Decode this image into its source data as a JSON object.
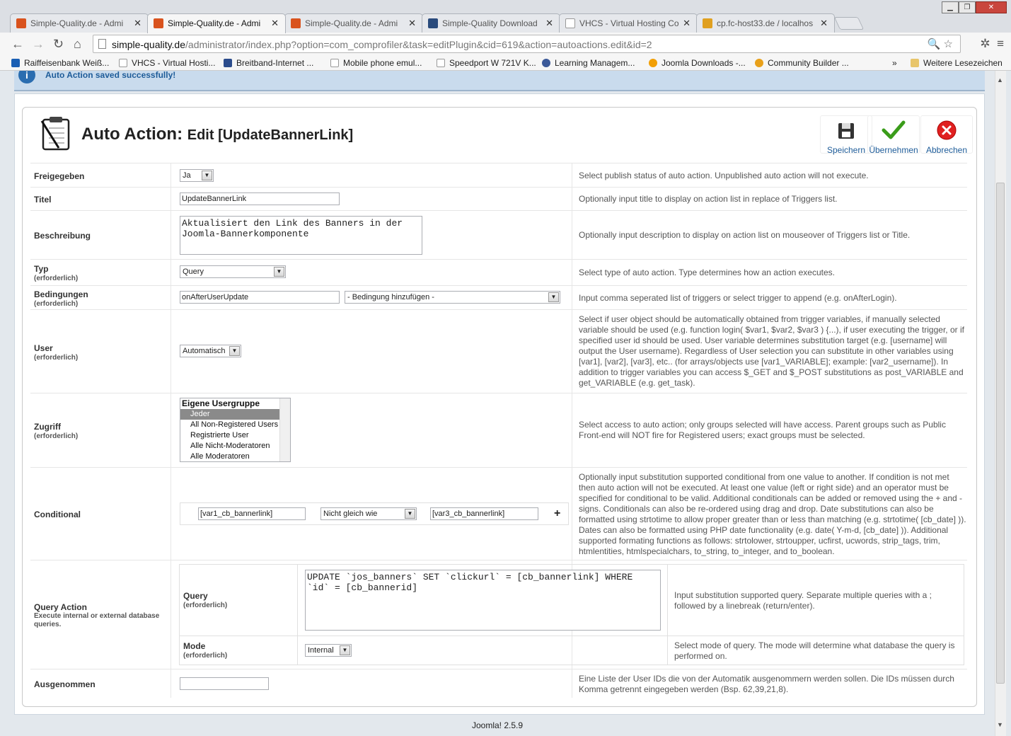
{
  "browser": {
    "tabs": [
      {
        "title": "Simple-Quality.de - Admi",
        "favicon_color": "#d9531e",
        "active": false
      },
      {
        "title": "Simple-Quality.de - Admi",
        "favicon_color": "#d9531e",
        "active": true
      },
      {
        "title": "Simple-Quality.de - Admi",
        "favicon_color": "#d9531e",
        "active": false
      },
      {
        "title": "Simple-Quality Download",
        "favicon_color": "#2a4b7c",
        "active": false
      },
      {
        "title": "VHCS - Virtual Hosting Co",
        "favicon_color": "#cccccc",
        "active": false
      },
      {
        "title": "cp.fc-host33.de / localhos",
        "favicon_color": "#e0a020",
        "active": false
      }
    ],
    "url_host": "simple-quality.de",
    "url_path": "/administrator/index.php?option=com_comprofiler&task=editPlugin&cid=619&action=autoactions.edit&id=2",
    "bookmarks": [
      {
        "label": "Raiffeisenbank Weiß...",
        "icon_color": "#1a5fb4"
      },
      {
        "label": "VHCS - Virtual Hosti...",
        "icon_color": "#dddddd"
      },
      {
        "label": "Breitband-Internet ...",
        "icon_color": "#2b4c8c"
      },
      {
        "label": "Mobile phone emul...",
        "icon_color": "#dddddd"
      },
      {
        "label": "Speedport W 721V K...",
        "icon_color": "#dddddd"
      },
      {
        "label": "Learning Managem...",
        "icon_color": "#3b5998"
      },
      {
        "label": "Joomla Downloads -...",
        "icon_color": "#f29f05"
      },
      {
        "label": "Community Builder ...",
        "icon_color": "#e8a01a"
      }
    ],
    "bookmarks_overflow": "»",
    "other_bookmarks": "Weitere Lesezeichen"
  },
  "message": "Auto Action saved successfully!",
  "page": {
    "title_main": "Auto Action:",
    "title_sub": "Edit [UpdateBannerLink]",
    "toolbar": {
      "save": "Speichern",
      "apply": "Übernehmen",
      "cancel": "Abbrechen"
    }
  },
  "required_label": "(erforderlich)",
  "form": {
    "published": {
      "label": "Freigegeben",
      "value": "Ja",
      "desc": "Select publish status of auto action. Unpublished auto action will not execute."
    },
    "title": {
      "label": "Titel",
      "value": "UpdateBannerLink",
      "desc": "Optionally input title to display on action list in replace of Triggers list."
    },
    "description": {
      "label": "Beschreibung",
      "value": "Aktualisiert den Link des Banners in der Joomla-Bannerkomponente",
      "desc": "Optionally input description to display on action list on mouseover of Triggers list or Title."
    },
    "type": {
      "label": "Typ",
      "value": "Query",
      "desc": "Select type of auto action. Type determines how an action executes."
    },
    "triggers": {
      "label": "Bedingungen",
      "value": "onAfterUserUpdate",
      "add_trigger": "- Bedingung hinzufügen -",
      "desc": "Input comma seperated list of triggers or select trigger to append (e.g. onAfterLogin)."
    },
    "user": {
      "label": "User",
      "value": "Automatisch",
      "desc": "Select if user object should be automatically obtained from trigger variables, if manually selected variable should be used (e.g. function login( $var1, $var2, $var3 ) {...), if user executing the trigger, or if specified user id should be used. User variable determines substitution target (e.g. [username] will output the User username). Regardless of User selection you can substitute in other variables using [var1], [var2], [var3], etc.. (for arrays/objects use [var1_VARIABLE]; example: [var2_username]). In addition to trigger variables you can access $_GET and $_POST substitutions as post_VARIABLE and get_VARIABLE (e.g. get_task)."
    },
    "access": {
      "label": "Zugriff",
      "group_header": "Eigene Usergruppe",
      "options": [
        "Jeder",
        "All Non-Registered Users",
        "Registrierte User",
        "Alle Nicht-Moderatoren",
        "Alle Moderatoren"
      ],
      "selected": "Jeder",
      "desc": "Select access to auto action; only groups selected will have access. Parent groups such as Public Front-end will NOT fire for Registered users; exact groups must be selected."
    },
    "conditional": {
      "label": "Conditional",
      "left": "[var1_cb_bannerlink]",
      "operator": "Nicht gleich wie",
      "right": "[var3_cb_bannerlink]",
      "add": "+",
      "desc": "Optionally input substitution supported conditional from one value to another. If condition is not met then auto action will not be executed. At least one value (left or right side) and an operator must be specified for conditional to be valid. Additional conditionals can be added or removed using the + and - signs. Conditionals can also be re-ordered using drag and drop. Date substitutions can also be formatted using strtotime to allow proper greater than or less than matching (e.g. strtotime( [cb_date] )). Dates can also be formatted using PHP date functionality (e.g. date( Y-m-d, [cb_date] )). Additional supported formating functions as follows: strtolower, strtoupper, ucfirst, ucwords, strip_tags, trim, htmlentities, htmlspecialchars, to_string, to_integer, and to_boolean."
    },
    "query_action": {
      "label": "Query Action",
      "sublabel": "Execute internal or external database queries.",
      "query_label": "Query",
      "query_value": "UPDATE `jos_banners` SET `clickurl` = [cb_bannerlink] WHERE `id` = [cb_bannerid]",
      "query_desc": "Input substitution supported query. Separate multiple queries with a ; followed by a linebreak (return/enter).",
      "mode_label": "Mode",
      "mode_value": "Internal",
      "mode_desc": "Select mode of query. The mode will determine what database the query is performed on."
    },
    "exclude": {
      "label": "Ausgenommen",
      "value": "",
      "desc": "Eine Liste der User IDs die von der Automatik ausgenommern werden sollen. Die IDs müssen durch Komma getrennt eingegeben werden (Bsp. 62,39,21,8)."
    }
  },
  "footer": "Joomla! 2.5.9"
}
